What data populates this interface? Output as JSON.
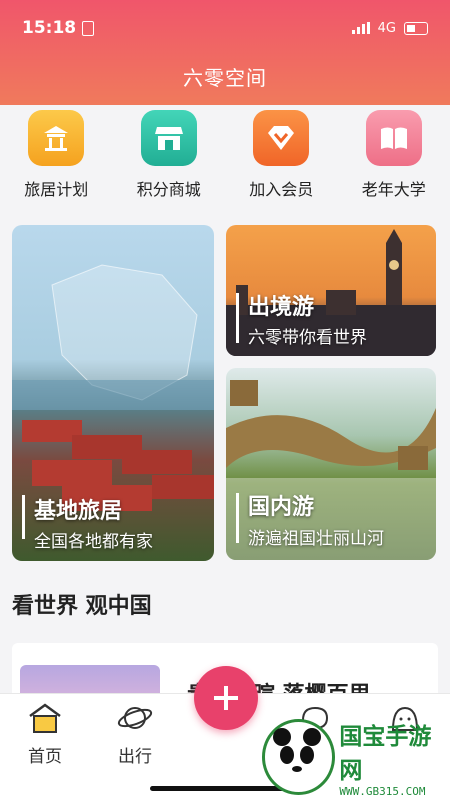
{
  "status": {
    "time": "15:18",
    "network": "4G"
  },
  "header": {
    "title": "六零空间"
  },
  "menu": [
    {
      "label": "旅居计划",
      "icon": "pavilion-icon",
      "color": "#f7b12a"
    },
    {
      "label": "积分商城",
      "icon": "shop-icon",
      "color": "#2fc1a6"
    },
    {
      "label": "加入会员",
      "icon": "diamond-icon",
      "color": "#f57a33"
    },
    {
      "label": "老年大学",
      "icon": "book-icon",
      "color": "#f2798f"
    }
  ],
  "cards": {
    "base": {
      "title": "基地旅居",
      "subtitle": "全国各地都有家"
    },
    "abroad": {
      "title": "出境游",
      "subtitle": "六零带你看世界"
    },
    "domestic": {
      "title": "国内游",
      "subtitle": "游遍祖国壮丽山河"
    }
  },
  "section": {
    "title": "看世界 观中国"
  },
  "feed": {
    "title": "贵宁春暄 落樱百里"
  },
  "tabs": [
    {
      "label": "首页",
      "icon": "home-icon"
    },
    {
      "label": "出行",
      "icon": "planet-icon"
    },
    {
      "label": "",
      "icon": "plus-icon"
    },
    {
      "label": "",
      "icon": "chat-icon"
    },
    {
      "label": "",
      "icon": "profile-icon"
    }
  ],
  "watermark": {
    "name": "国宝手游网",
    "url": "WWW.GB315.COM"
  },
  "colors": {
    "accent": "#e8416b",
    "header_top": "#f0566b",
    "header_bottom": "#f07a5c"
  }
}
